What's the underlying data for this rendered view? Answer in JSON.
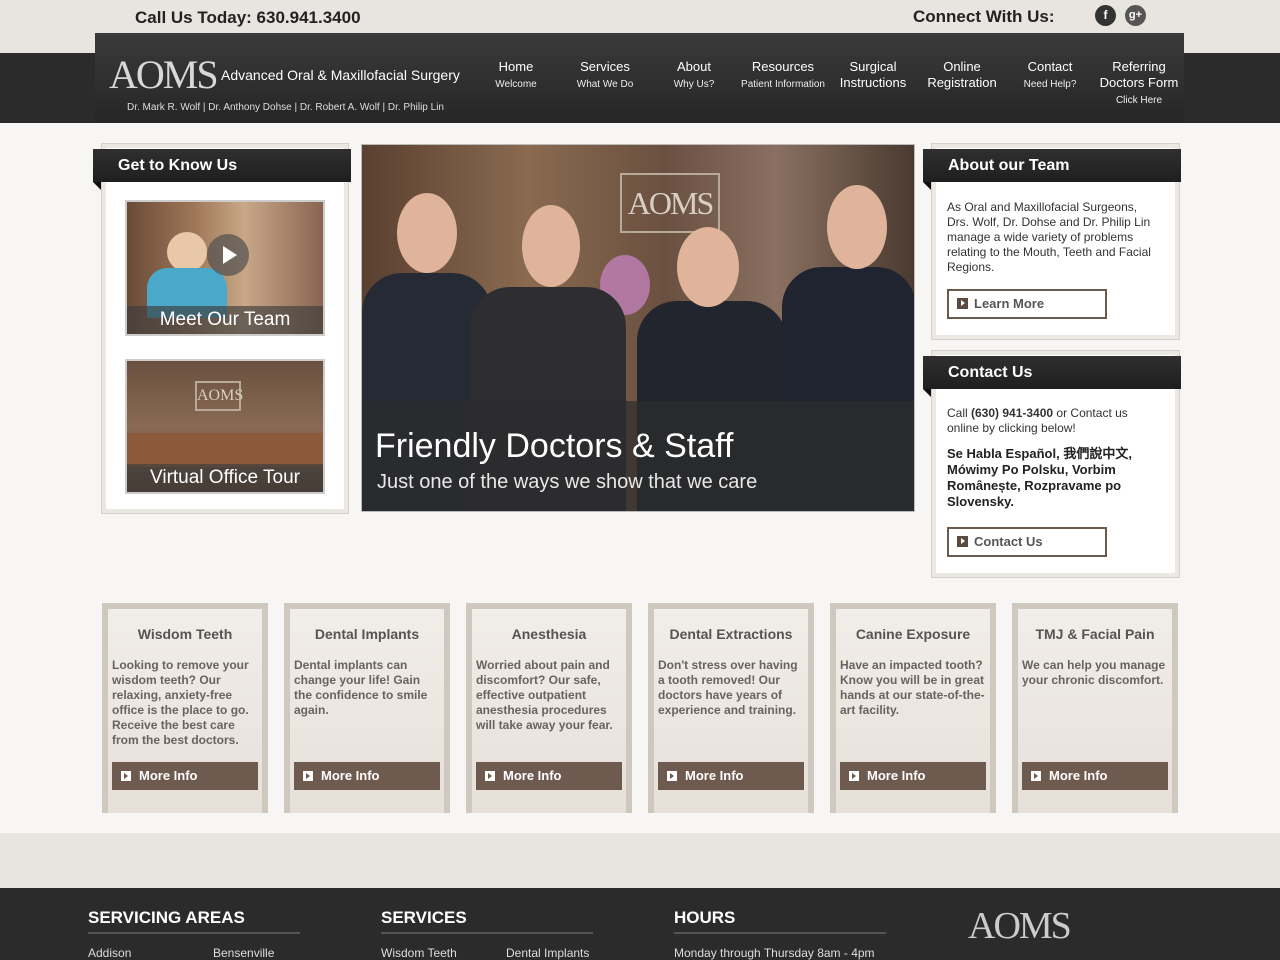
{
  "topbar": {
    "call": "Call Us Today: 630.941.3400",
    "connect": "Connect With Us:",
    "facebook_glyph": "f",
    "google_glyph": "g+"
  },
  "header": {
    "logo_mark": "AOMS",
    "practice_name": "Advanced Oral & Maxillofacial Surgery",
    "doctors": "Dr. Mark R. Wolf | Dr. Anthony Dohse | Dr. Robert A. Wolf | Dr. Philip Lin"
  },
  "nav": [
    {
      "label": "Home",
      "sub": "Welcome"
    },
    {
      "label": "Services",
      "sub": "What We Do"
    },
    {
      "label": "About",
      "sub": "Why Us?"
    },
    {
      "label": "Resources",
      "sub": "Patient Information"
    },
    {
      "label": "Surgical",
      "label2": "Instructions"
    },
    {
      "label": "Online",
      "label2": "Registration"
    },
    {
      "label": "Contact",
      "sub": "Need Help?"
    },
    {
      "label": "Referring",
      "label2": "Doctors Form",
      "sub": "Click Here"
    }
  ],
  "get_to_know": {
    "title": "Get to Know Us",
    "video_caption": "Meet Our Team",
    "tour_caption": "Virtual Office Tour",
    "sign_text": "AOMS"
  },
  "hero": {
    "sign_text": "AOMS",
    "headline": "Friendly Doctors & Staff",
    "subline": "Just one of the ways we show that we care"
  },
  "about_team": {
    "title": "About our Team",
    "text": "As Oral and Maxillofacial Surgeons, Drs. Wolf, Dr. Dohse and Dr. Philip Lin manage a wide variety of problems relating to the Mouth, Teeth and Facial Regions.",
    "button": "Learn More"
  },
  "contact": {
    "title": "Contact Us",
    "text_pre": "Call ",
    "phone": "(630) 941-3400",
    "text_post": " or Contact us online by clicking below!",
    "languages": "Se Habla Español, 我們說中文, Mówimy Po Polsku, Vorbim Românește, Rozpravame po Slovensky.",
    "button": "Contact Us"
  },
  "services": [
    {
      "title": "Wisdom Teeth",
      "text": "Looking to remove your wisdom teeth? Our relaxing, anxiety-free office is the place to go. Receive the best care from the best doctors.",
      "button": "More Info"
    },
    {
      "title": "Dental Implants",
      "text": "Dental implants can change your life! Gain the confidence to smile again.",
      "button": "More Info"
    },
    {
      "title": "Anesthesia",
      "text": "Worried about pain and discomfort? Our safe, effective outpatient anesthesia procedures will take away your fear.",
      "button": "More Info"
    },
    {
      "title": "Dental Extractions",
      "text": "Don't stress over having a tooth removed! Our doctors have years of experience and training.",
      "button": "More Info"
    },
    {
      "title": "Canine Exposure",
      "text": "Have an impacted tooth? Know you will be in great hands at our state-of-the-art facility.",
      "button": "More Info"
    },
    {
      "title": "TMJ & Facial Pain",
      "text": "We can help you manage your chronic discomfort.",
      "button": "More Info"
    }
  ],
  "footer": {
    "areas_title": "SERVICING AREAS",
    "areas": [
      "Addison",
      "Bensenville"
    ],
    "services_title": "SERVICES",
    "services": [
      "Wisdom Teeth",
      "Dental Implants"
    ],
    "hours_title": "HOURS",
    "hours": "Monday through Thursday 8am - 4pm",
    "logo_mark": "AOMS"
  }
}
